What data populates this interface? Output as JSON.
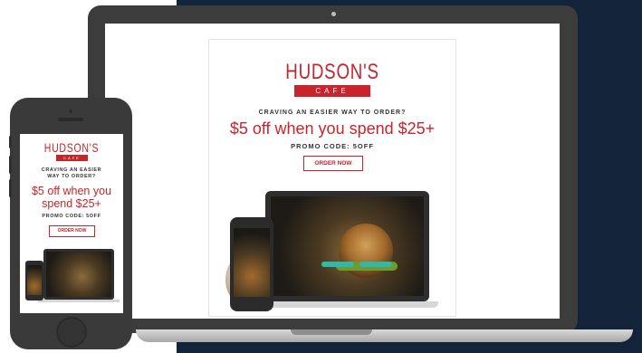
{
  "brand": {
    "name": "HUDSON'S",
    "sub": "CAFE",
    "color": "#c8242b"
  },
  "email": {
    "craving": "CRAVING AN EASIER WAY TO ORDER?",
    "headline": "$5 off when you spend $25+",
    "promo": "PROMO CODE: 5OFF",
    "order_button": "ORDER NOW"
  },
  "phone_email": {
    "craving_line1": "CRAVING AN EASIER",
    "craving_line2": "WAY TO ORDER?",
    "headline_line1": "$5 off when you",
    "headline_line2": "spend $25+",
    "promo": "PROMO CODE: 5OFF",
    "order_button": "ORDER NOW"
  },
  "colors": {
    "background_navy": "#13233a",
    "device_dark": "#3c3c3c"
  }
}
